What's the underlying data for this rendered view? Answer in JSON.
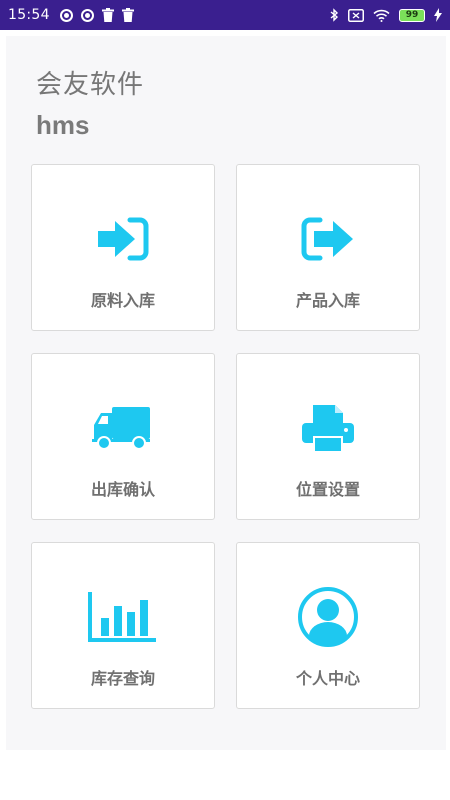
{
  "status_bar": {
    "time": "15:54",
    "battery": "99",
    "left_icons": [
      "record-icon",
      "record-icon",
      "trash-icon",
      "trash-icon"
    ],
    "right_icons": [
      "bluetooth-icon",
      "mute-box-icon",
      "wifi-icon",
      "battery-icon",
      "charging-icon"
    ]
  },
  "header": {
    "title_cn": "会友软件",
    "title_en": "hms"
  },
  "accent_color": "#1ec8f0",
  "tiles": [
    {
      "label": "原料入库",
      "icon": "import-login-icon"
    },
    {
      "label": "产品入库",
      "icon": "export-logout-icon"
    },
    {
      "label": "出库确认",
      "icon": "truck-icon"
    },
    {
      "label": "位置设置",
      "icon": "printer-icon"
    },
    {
      "label": "库存查询",
      "icon": "bar-chart-icon"
    },
    {
      "label": "个人中心",
      "icon": "user-circle-icon"
    }
  ]
}
